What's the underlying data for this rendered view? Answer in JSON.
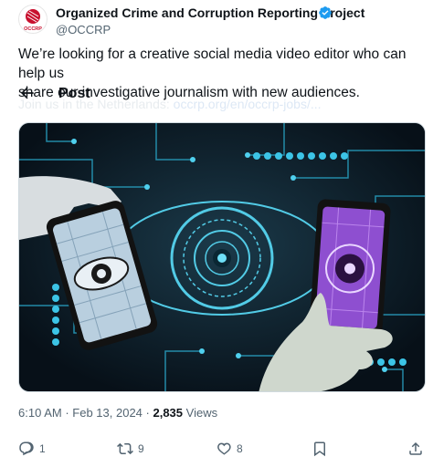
{
  "account": {
    "display_name": "Organized Crime and Corruption Reporting Project",
    "handle": "@OCCRP",
    "avatar_text": "OCCRP",
    "verified": true
  },
  "post": {
    "text_line1": "We’re looking for a creative social media video editor who can help us",
    "text_line2": "share our investigative journalism with new audiences.",
    "faded_text": "Join us in the Netherlands: ",
    "faded_link": "occrp.org/en/occrp-jobs/...",
    "heading": "Post",
    "time": "6:10 AM",
    "date": "Feb 13, 2024",
    "views_count": "2,835",
    "views_label": "Views"
  },
  "actions": {
    "replies": "1",
    "reposts": "9",
    "likes": "8"
  },
  "colors": {
    "verified_blue": "#1d9bf0",
    "text_secondary": "#536471",
    "brand_red": "#c8102e"
  }
}
